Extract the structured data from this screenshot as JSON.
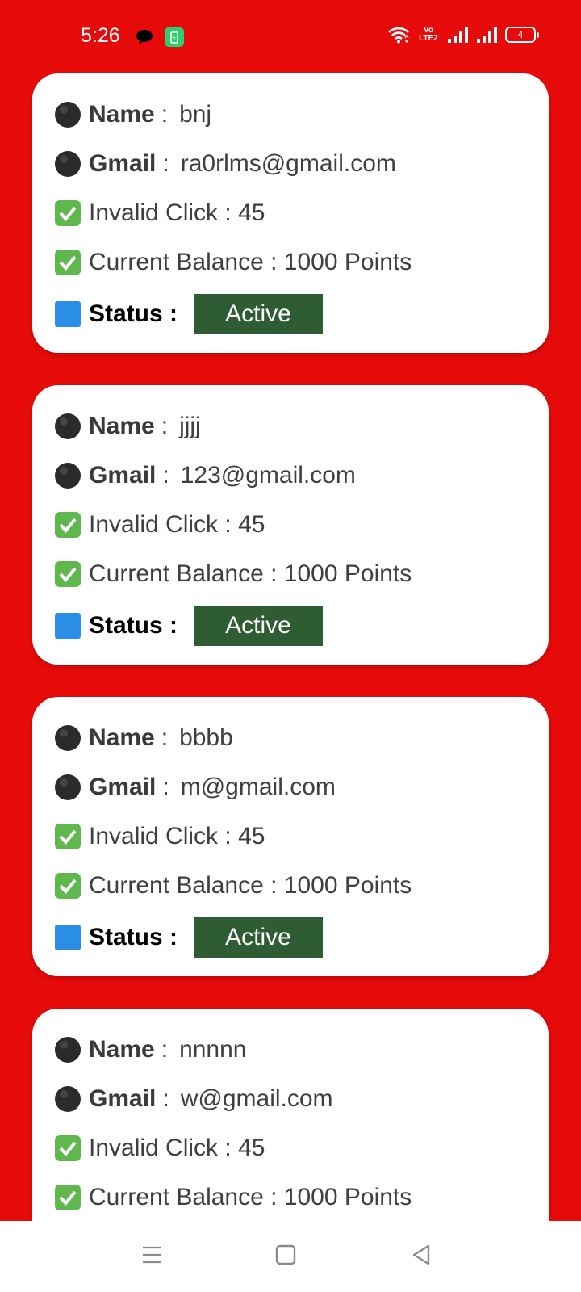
{
  "status_bar": {
    "time": "5:26",
    "battery_level": "4",
    "network_label": "Vo LTE2"
  },
  "labels": {
    "name": "Name",
    "gmail": "Gmail",
    "colon": ":",
    "invalid_click": "Invalid Click : ",
    "current_balance": "Current Balance : ",
    "status": "Status :"
  },
  "users": [
    {
      "name": "bnj",
      "gmail": "ra0rlms@gmail.com",
      "invalid_click": "45",
      "balance": "1000 Points",
      "status": "Active"
    },
    {
      "name": "jjjj",
      "gmail": "123@gmail.com",
      "invalid_click": "45",
      "balance": "1000 Points",
      "status": "Active"
    },
    {
      "name": "bbbb",
      "gmail": "m@gmail.com",
      "invalid_click": "45",
      "balance": "1000 Points",
      "status": "Active"
    },
    {
      "name": "nnnnn",
      "gmail": "w@gmail.com",
      "invalid_click": "45",
      "balance": "1000 Points"
    }
  ],
  "colors": {
    "background": "#e70a0a",
    "active_badge": "#2f5d33",
    "card": "#ffffff"
  }
}
